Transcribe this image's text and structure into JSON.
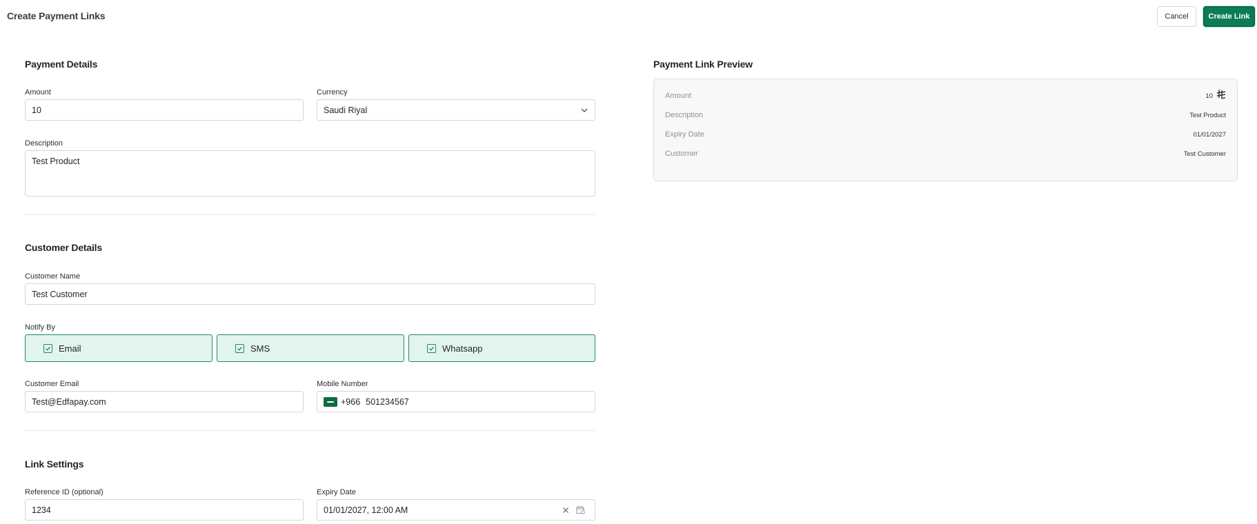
{
  "header": {
    "title": "Create Payment Links",
    "cancel_label": "Cancel",
    "create_label": "Create Link"
  },
  "payment_details": {
    "title": "Payment Details",
    "amount_label": "Amount",
    "amount_value": "10",
    "currency_label": "Currency",
    "currency_value": "Saudi Riyal",
    "description_label": "Description",
    "description_value": "Test Product"
  },
  "customer_details": {
    "title": "Customer Details",
    "name_label": "Customer Name",
    "name_value": "Test Customer",
    "notify_label": "Notify By",
    "notify_options": [
      {
        "label": "Email",
        "checked": true
      },
      {
        "label": "SMS",
        "checked": true
      },
      {
        "label": "Whatsapp",
        "checked": true
      }
    ],
    "email_label": "Customer Email",
    "email_value": "Test@Edfapay.com",
    "mobile_label": "Mobile Number",
    "mobile_code": "+966",
    "mobile_value": "501234567"
  },
  "link_settings": {
    "title": "Link Settings",
    "reference_label": "Reference ID (optional)",
    "reference_value": "1234",
    "expiry_label": "Expiry Date",
    "expiry_value": "01/01/2027, 12:00 AM"
  },
  "preview": {
    "title": "Payment Link Preview",
    "rows": [
      {
        "label": "Amount",
        "value": "10",
        "currency_symbol": "⃁"
      },
      {
        "label": "Description",
        "value": "Test Product"
      },
      {
        "label": "Expiry Date",
        "value": "01/01/2027"
      },
      {
        "label": "Customer",
        "value": "Test Customer"
      }
    ]
  },
  "colors": {
    "accent": "#0c7c58",
    "notify_bg": "#e2f4ee",
    "notify_border": "#1d8a63"
  },
  "icons": [
    "chevron-down-icon",
    "checkbox-checked-icon",
    "saudi-flag-icon",
    "clear-icon",
    "calendar-icon",
    "riyal-symbol-icon"
  ]
}
